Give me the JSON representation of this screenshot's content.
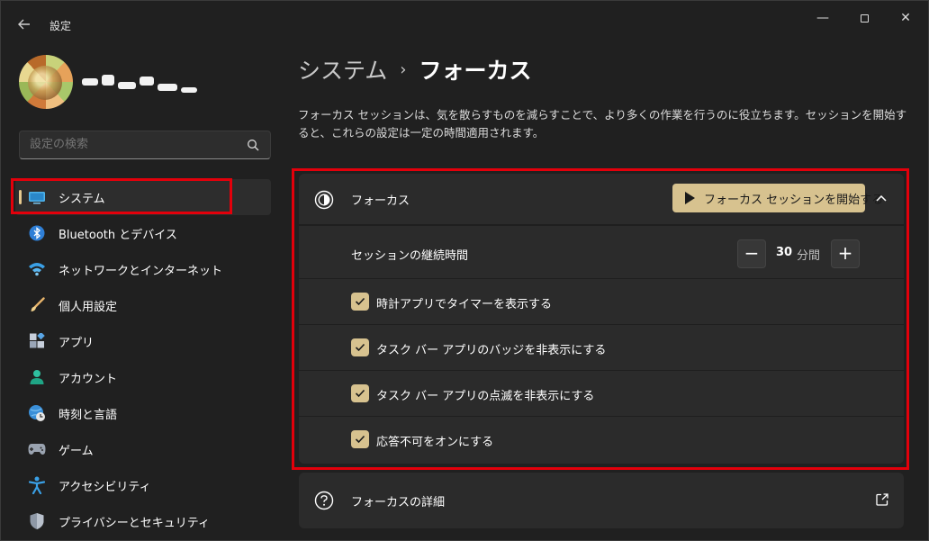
{
  "window": {
    "title": "設定",
    "back_icon": "arrow-left-icon",
    "controls": {
      "minimize": "—",
      "maximize": "maximize-icon",
      "close": "✕"
    }
  },
  "search": {
    "placeholder": "設定の検索",
    "icon": "search-icon"
  },
  "sidebar": {
    "items": [
      {
        "label": "システム",
        "icon": "monitor-icon",
        "active": true
      },
      {
        "label": "Bluetooth とデバイス",
        "icon": "bluetooth-icon"
      },
      {
        "label": "ネットワークとインターネット",
        "icon": "wifi-icon"
      },
      {
        "label": "個人用設定",
        "icon": "brush-icon"
      },
      {
        "label": "アプリ",
        "icon": "apps-icon"
      },
      {
        "label": "アカウント",
        "icon": "person-icon"
      },
      {
        "label": "時刻と言語",
        "icon": "globe-clock-icon"
      },
      {
        "label": "ゲーム",
        "icon": "gamepad-icon"
      },
      {
        "label": "アクセシビリティ",
        "icon": "accessibility-icon"
      },
      {
        "label": "プライバシーとセキュリティ",
        "icon": "shield-icon"
      }
    ]
  },
  "breadcrumb": {
    "parent": "システム",
    "separator": "›",
    "current": "フォーカス"
  },
  "description": "フォーカス セッションは、気を散らすものを減らすことで、より多くの作業を行うのに役立ちます。セッションを開始すると、これらの設定は一定の時間適用されます。",
  "focus_panel": {
    "title": "フォーカス",
    "start_button": "フォーカス セッションを開始する",
    "duration": {
      "label": "セッションの継続時間",
      "value": "30",
      "unit": "分間",
      "decrement": "−",
      "increment": "+"
    },
    "options": [
      {
        "label": "時計アプリでタイマーを表示する",
        "checked": true
      },
      {
        "label": "タスク バー アプリのバッジを非表示にする",
        "checked": true
      },
      {
        "label": "タスク バー アプリの点滅を非表示にする",
        "checked": true
      },
      {
        "label": "応答不可をオンにする",
        "checked": true
      }
    ]
  },
  "details": {
    "label": "フォーカスの詳細"
  },
  "colors": {
    "accent": "#d7c28f",
    "highlight": "#e3000b",
    "background": "#202020",
    "card": "#2b2b2b"
  }
}
